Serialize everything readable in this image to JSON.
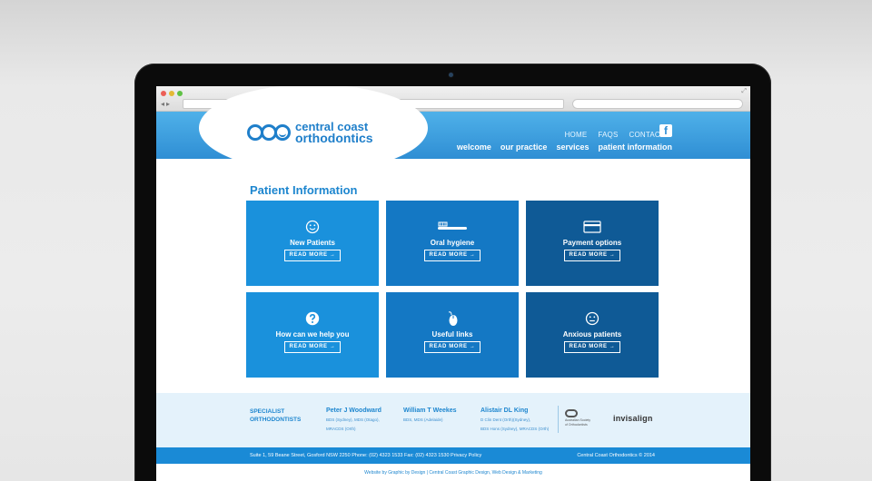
{
  "browser": {
    "url_placeholder": "",
    "search_placeholder": ""
  },
  "site": {
    "logo_line1": "central coast",
    "logo_line2": "orthodontics",
    "top_nav": [
      "HOME",
      "FAQS",
      "CONTACT"
    ],
    "facebook_glyph": "f",
    "main_nav": [
      "welcome",
      "our practice",
      "services",
      "patient information"
    ]
  },
  "page": {
    "title": "Patient Information",
    "read_more": "READ MORE →",
    "tiles": [
      {
        "label": "New Patients",
        "icon": "smiley-icon",
        "color": "#1a91dc"
      },
      {
        "label": "Oral hygiene",
        "icon": "toothbrush-icon",
        "color": "#1478c4"
      },
      {
        "label": "Payment options",
        "icon": "credit-card-icon",
        "color": "#0f5a96"
      },
      {
        "label": "How can we help you",
        "icon": "question-icon",
        "color": "#1a91dc"
      },
      {
        "label": "Useful links",
        "icon": "mouse-icon",
        "color": "#1478c4"
      },
      {
        "label": "Anxious patients",
        "icon": "neutral-face-icon",
        "color": "#0f5a96"
      }
    ]
  },
  "footer": {
    "specialist_line1": "SPECIALIST",
    "specialist_line2": "ORTHODONTISTS",
    "doctors": [
      {
        "name": "Peter J Woodward",
        "q1": "BDS (Sydney), MDS (Otago),",
        "q2": "MRACDS (Orth)"
      },
      {
        "name": "William T Weekes",
        "q1": "BDS, MDS (Adelaide)",
        "q2": ""
      },
      {
        "name": "Alistair DL King",
        "q1": "D Clin Dent (Orth)(Sydney),",
        "q2": "BDS Hons (Sydney), MRACDS (Orth)"
      }
    ],
    "aso_text1": "Australian Society",
    "aso_text2": "of Orthodontists",
    "invisalign": "invisalign",
    "address": "Suite 1, 59 Beane Street, Gosford NSW 2250 Phone: (02) 4323 1533 Fax: (02) 4323 1530 Privacy Policy",
    "copyright": "Central Coast Orthodontics © 2014",
    "credit": "Website by Graphic by Design | Central Coast Graphic Design, Web Design & Marketing"
  },
  "colors": {
    "brand_blue": "#1d86cf",
    "tile_light": "#1a91dc",
    "tile_mid": "#1478c4",
    "tile_dark": "#0f5a96"
  }
}
